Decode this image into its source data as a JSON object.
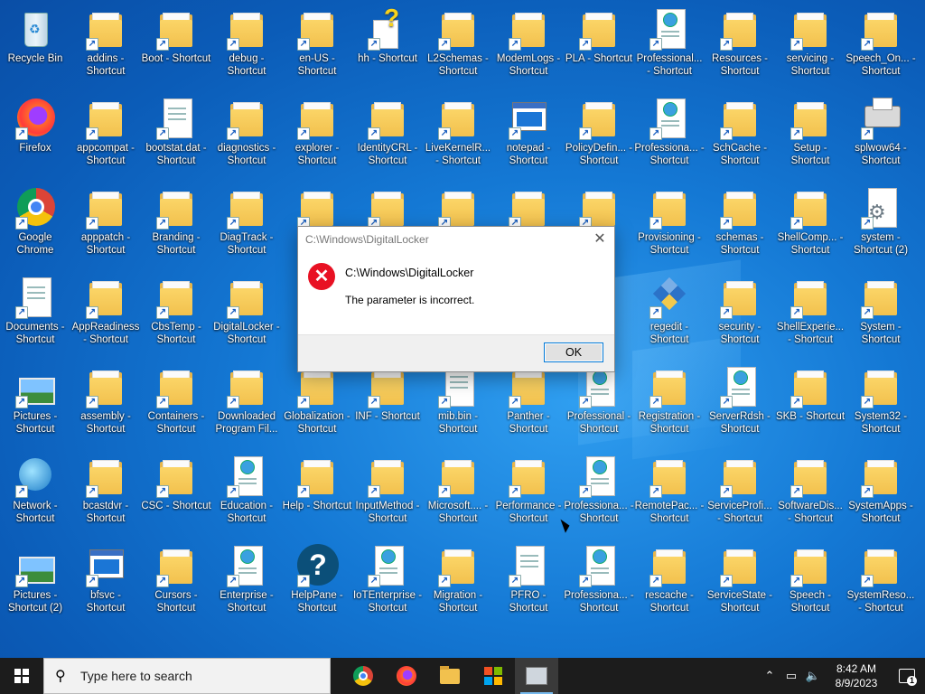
{
  "desktop": {
    "icons": [
      {
        "label": "Recycle Bin",
        "type": "recycle",
        "shortcut": false
      },
      {
        "label": "addins - Shortcut",
        "type": "folder",
        "shortcut": true
      },
      {
        "label": "Boot - Shortcut",
        "type": "folder",
        "shortcut": true
      },
      {
        "label": "debug - Shortcut",
        "type": "folder",
        "shortcut": true
      },
      {
        "label": "en-US - Shortcut",
        "type": "folder",
        "shortcut": true
      },
      {
        "label": "hh - Shortcut",
        "type": "hh",
        "shortcut": true
      },
      {
        "label": "L2Schemas - Shortcut",
        "type": "folder",
        "shortcut": true
      },
      {
        "label": "ModemLogs - Shortcut",
        "type": "folder",
        "shortcut": true
      },
      {
        "label": "PLA - Shortcut",
        "type": "folder",
        "shortcut": true
      },
      {
        "label": "Professional... - Shortcut",
        "type": "webdoc",
        "shortcut": true
      },
      {
        "label": "Resources - Shortcut",
        "type": "folder",
        "shortcut": true
      },
      {
        "label": "servicing - Shortcut",
        "type": "folder",
        "shortcut": true
      },
      {
        "label": "Speech_On... - Shortcut",
        "type": "folder",
        "shortcut": true
      },
      {
        "label": "Firefox",
        "type": "firefox",
        "shortcut": true
      },
      {
        "label": "appcompat - Shortcut",
        "type": "folder",
        "shortcut": true
      },
      {
        "label": "bootstat.dat - Shortcut",
        "type": "doc",
        "shortcut": true
      },
      {
        "label": "diagnostics - Shortcut",
        "type": "folder",
        "shortcut": true
      },
      {
        "label": "explorer - Shortcut",
        "type": "folder",
        "shortcut": true
      },
      {
        "label": "IdentityCRL - Shortcut",
        "type": "folder",
        "shortcut": true
      },
      {
        "label": "LiveKernelR... - Shortcut",
        "type": "folder",
        "shortcut": true
      },
      {
        "label": "notepad - Shortcut",
        "type": "appwin",
        "shortcut": true
      },
      {
        "label": "PolicyDefin... - Shortcut",
        "type": "folder",
        "shortcut": true
      },
      {
        "label": "Professiona... - Shortcut",
        "type": "webdoc",
        "shortcut": true
      },
      {
        "label": "SchCache - Shortcut",
        "type": "folder",
        "shortcut": true
      },
      {
        "label": "Setup - Shortcut",
        "type": "folder",
        "shortcut": true
      },
      {
        "label": "splwow64 - Shortcut",
        "type": "printer",
        "shortcut": true
      },
      {
        "label": "Google Chrome",
        "type": "chrome",
        "shortcut": true
      },
      {
        "label": "apppatch - Shortcut",
        "type": "folder",
        "shortcut": true
      },
      {
        "label": "Branding - Shortcut",
        "type": "folder",
        "shortcut": true
      },
      {
        "label": "DiagTrack - Shortcut",
        "type": "folder",
        "shortcut": true
      },
      {
        "label": "",
        "type": "folder",
        "shortcut": true
      },
      {
        "label": "",
        "type": "folder",
        "shortcut": true
      },
      {
        "label": "",
        "type": "folder",
        "shortcut": true
      },
      {
        "label": "",
        "type": "folder",
        "shortcut": true
      },
      {
        "label": "",
        "type": "folder",
        "shortcut": true
      },
      {
        "label": "Provisioning - Shortcut",
        "type": "folder",
        "shortcut": true
      },
      {
        "label": "schemas - Shortcut",
        "type": "folder",
        "shortcut": true
      },
      {
        "label": "ShellComp... - Shortcut",
        "type": "folder",
        "shortcut": true
      },
      {
        "label": "system - Shortcut (2)",
        "type": "gear",
        "shortcut": true
      },
      {
        "label": "Documents - Shortcut",
        "type": "doc",
        "shortcut": true
      },
      {
        "label": "AppReadiness - Shortcut",
        "type": "folder",
        "shortcut": true
      },
      {
        "label": "CbsTemp - Shortcut",
        "type": "folder",
        "shortcut": true
      },
      {
        "label": "DigitalLocker - Shortcut",
        "type": "folder",
        "shortcut": true
      },
      {
        "label": "",
        "type": "folder",
        "shortcut": true
      },
      {
        "label": "",
        "type": "folder",
        "shortcut": true
      },
      {
        "label": "",
        "type": "folder",
        "shortcut": true
      },
      {
        "label": "",
        "type": "folder",
        "shortcut": true
      },
      {
        "label": "",
        "type": "folder",
        "shortcut": true
      },
      {
        "label": "regedit - Shortcut",
        "type": "regedit",
        "shortcut": true
      },
      {
        "label": "security - Shortcut",
        "type": "folder",
        "shortcut": true
      },
      {
        "label": "ShellExperie... - Shortcut",
        "type": "folder",
        "shortcut": true
      },
      {
        "label": "System - Shortcut",
        "type": "folder",
        "shortcut": true
      },
      {
        "label": "Pictures - Shortcut",
        "type": "pictures",
        "shortcut": true
      },
      {
        "label": "assembly - Shortcut",
        "type": "folder",
        "shortcut": true
      },
      {
        "label": "Containers - Shortcut",
        "type": "folder",
        "shortcut": true
      },
      {
        "label": "Downloaded Program Fil...",
        "type": "folder",
        "shortcut": true
      },
      {
        "label": "Globalization - Shortcut",
        "type": "folder",
        "shortcut": true
      },
      {
        "label": "INF - Shortcut",
        "type": "folder",
        "shortcut": true
      },
      {
        "label": "mib.bin - Shortcut",
        "type": "doc",
        "shortcut": true
      },
      {
        "label": "Panther - Shortcut",
        "type": "folder",
        "shortcut": true
      },
      {
        "label": "Professional - Shortcut",
        "type": "webdoc",
        "shortcut": true
      },
      {
        "label": "Registration - Shortcut",
        "type": "folder",
        "shortcut": true
      },
      {
        "label": "ServerRdsh - Shortcut",
        "type": "webdoc",
        "shortcut": true
      },
      {
        "label": "SKB - Shortcut",
        "type": "folder",
        "shortcut": true
      },
      {
        "label": "System32 - Shortcut",
        "type": "folder",
        "shortcut": true
      },
      {
        "label": "Network - Shortcut",
        "type": "network",
        "shortcut": true
      },
      {
        "label": "bcastdvr - Shortcut",
        "type": "folder",
        "shortcut": true
      },
      {
        "label": "CSC - Shortcut",
        "type": "folder",
        "shortcut": true
      },
      {
        "label": "Education - Shortcut",
        "type": "webdoc",
        "shortcut": true
      },
      {
        "label": "Help - Shortcut",
        "type": "folder",
        "shortcut": true
      },
      {
        "label": "InputMethod - Shortcut",
        "type": "folder",
        "shortcut": true
      },
      {
        "label": "Microsoft.... - Shortcut",
        "type": "folder",
        "shortcut": true
      },
      {
        "label": "Performance - Shortcut",
        "type": "folder",
        "shortcut": true
      },
      {
        "label": "Professiona... - Shortcut",
        "type": "webdoc",
        "shortcut": true
      },
      {
        "label": "RemotePac... - Shortcut",
        "type": "folder",
        "shortcut": true
      },
      {
        "label": "ServiceProfi... - Shortcut",
        "type": "folder",
        "shortcut": true
      },
      {
        "label": "SoftwareDis... - Shortcut",
        "type": "folder",
        "shortcut": true
      },
      {
        "label": "SystemApps - Shortcut",
        "type": "folder",
        "shortcut": true
      },
      {
        "label": "Pictures - Shortcut (2)",
        "type": "pictures",
        "shortcut": true
      },
      {
        "label": "bfsvc - Shortcut",
        "type": "appwin",
        "shortcut": true
      },
      {
        "label": "Cursors - Shortcut",
        "type": "folder",
        "shortcut": true
      },
      {
        "label": "Enterprise - Shortcut",
        "type": "webdoc",
        "shortcut": true
      },
      {
        "label": "HelpPane - Shortcut",
        "type": "helpcircle",
        "shortcut": true
      },
      {
        "label": "IoTEnterprise - Shortcut",
        "type": "webdoc",
        "shortcut": true
      },
      {
        "label": "Migration - Shortcut",
        "type": "folder",
        "shortcut": true
      },
      {
        "label": "PFRO - Shortcut",
        "type": "doc",
        "shortcut": true
      },
      {
        "label": "Professiona... - Shortcut",
        "type": "webdoc",
        "shortcut": true
      },
      {
        "label": "rescache - Shortcut",
        "type": "folder",
        "shortcut": true
      },
      {
        "label": "ServiceState - Shortcut",
        "type": "folder",
        "shortcut": true
      },
      {
        "label": "Speech - Shortcut",
        "type": "folder",
        "shortcut": true
      },
      {
        "label": "SystemReso... - Shortcut",
        "type": "folder",
        "shortcut": true
      }
    ]
  },
  "dialog": {
    "title": "C:\\Windows\\DigitalLocker",
    "path": "C:\\Windows\\DigitalLocker",
    "message": "The parameter is incorrect.",
    "ok_label": "OK",
    "close_glyph": "✕",
    "error_glyph": "✕"
  },
  "taskbar": {
    "search_placeholder": "Type here to search",
    "apps": [
      "chrome-icon",
      "firefox-icon",
      "file-explorer-icon",
      "store-icon",
      "window-app-icon"
    ],
    "time": "8:42 AM",
    "date": "8/9/2023",
    "notification_count": "1"
  }
}
